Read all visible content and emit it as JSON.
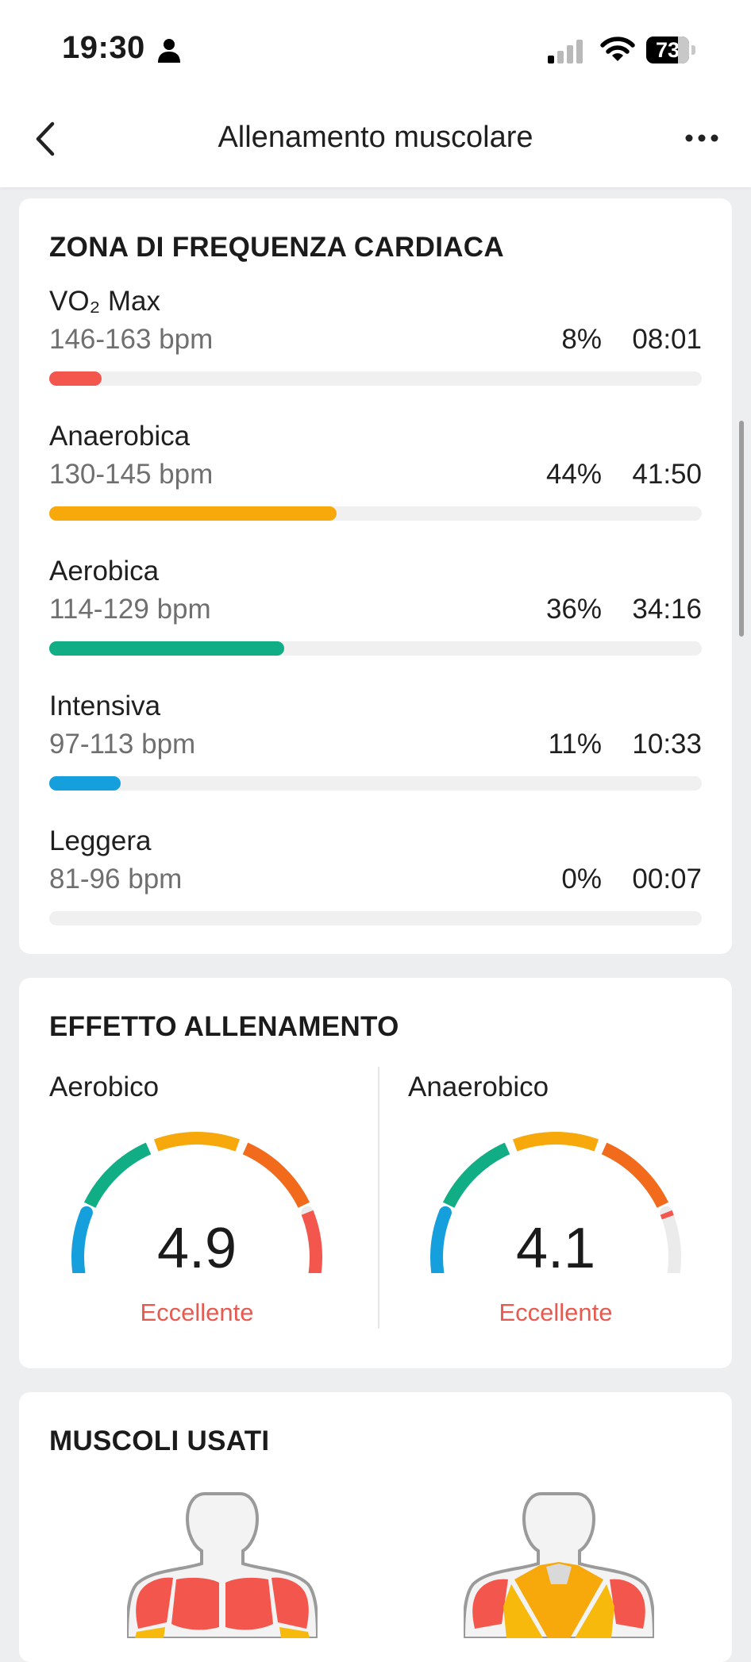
{
  "status_bar": {
    "time": "19:30",
    "battery": "73"
  },
  "nav": {
    "title": "Allenamento muscolare"
  },
  "heart_rate_zones": {
    "title": "ZONA DI FREQUENZA CARDIACA",
    "zones": [
      {
        "name": "VO₂ Max",
        "range": "146-163 bpm",
        "percent": "8%",
        "time": "08:01",
        "fill_fraction": 0.08,
        "color": "#F2564D"
      },
      {
        "name": "Anaerobica",
        "range": "130-145 bpm",
        "percent": "44%",
        "time": "41:50",
        "fill_fraction": 0.44,
        "color": "#F7A90C"
      },
      {
        "name": "Aerobica",
        "range": "114-129 bpm",
        "percent": "36%",
        "time": "34:16",
        "fill_fraction": 0.36,
        "color": "#11AD85"
      },
      {
        "name": "Intensiva",
        "range": "97-113 bpm",
        "percent": "11%",
        "time": "10:33",
        "fill_fraction": 0.11,
        "color": "#169FDD"
      },
      {
        "name": "Leggera",
        "range": "81-96 bpm",
        "percent": "0%",
        "time": "00:07",
        "fill_fraction": 0.0,
        "color": "#9E9E9E"
      }
    ]
  },
  "training_effect": {
    "title": "EFFETTO ALLENAMENTO",
    "aerobic": {
      "label": "Aerobico",
      "value": "4.9",
      "status": "Eccellente",
      "level": 4.9
    },
    "anaerobic": {
      "label": "Anaerobico",
      "value": "4.1",
      "status": "Eccellente",
      "level": 4.1
    },
    "scale_max": 5,
    "segment_colors": [
      "#169FDD",
      "#11AD85",
      "#F7A90C",
      "#F26B1D",
      "#F2564D"
    ],
    "inactive_color": "#EBEBEB"
  },
  "muscles": {
    "title": "MUSCOLI USATI"
  }
}
